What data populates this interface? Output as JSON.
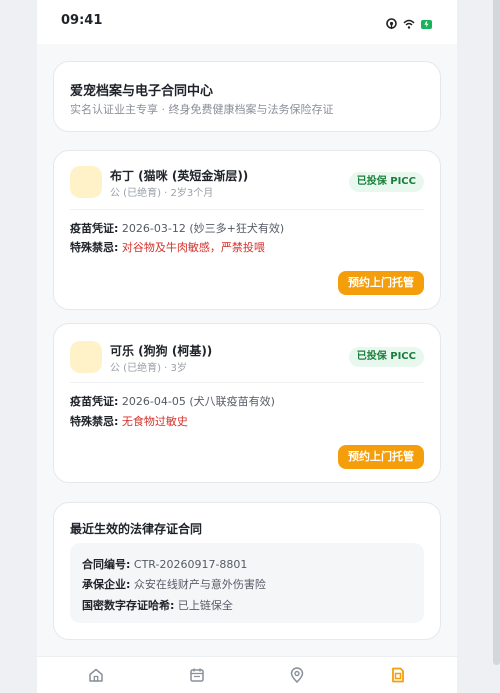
{
  "status": {
    "time": "09:41"
  },
  "header": {
    "title": "爱宠档案与电子合同中心",
    "subtitle": "实名认证业主专享 · 终身免费健康档案与法务保险存证"
  },
  "pets": [
    {
      "name": "布丁 (猫咪 (英短金渐层))",
      "meta": "公 (已绝育) · 2岁3个月",
      "badge": "已投保 PICC",
      "vaccine_label": "疫苗凭证:",
      "vaccine_value": "2026-03-12 (妙三多+狂犬有效)",
      "taboo_label": "特殊禁忌:",
      "taboo_value": "对谷物及牛肉敏感，严禁投喂",
      "button": "预约上门托管"
    },
    {
      "name": "可乐 (狗狗 (柯基))",
      "meta": "公 (已绝育) · 3岁",
      "badge": "已投保 PICC",
      "vaccine_label": "疫苗凭证:",
      "vaccine_value": "2026-04-05 (犬八联疫苗有效)",
      "taboo_label": "特殊禁忌:",
      "taboo_value": "无食物过敏史",
      "button": "预约上门托管"
    }
  ],
  "contract": {
    "title": "最近生效的法律存证合同",
    "no_label": "合同编号:",
    "no_value": "CTR-20260917-8801",
    "insurer_label": "承保企业:",
    "insurer_value": "众安在线财产与意外伤害险",
    "hash_label": "国密数字存证哈希:",
    "hash_value": "已上链保全"
  },
  "tabs": [
    {
      "icon": "home-icon",
      "active": false
    },
    {
      "icon": "calendar-icon",
      "active": false
    },
    {
      "icon": "location-icon",
      "active": false
    },
    {
      "icon": "document-icon",
      "active": true
    }
  ],
  "colors": {
    "accent": "#f59e0b",
    "insured": "#1a7f3c",
    "warning": "#d4322c"
  }
}
